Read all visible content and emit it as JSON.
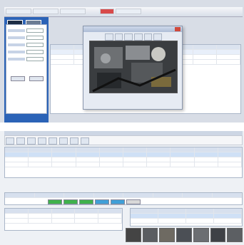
{
  "top": {
    "tabs": [
      "",
      "",
      "",
      "",
      "",
      "",
      "",
      ""
    ],
    "active_tab_index": 4,
    "left_table_headers": [
      "",
      "",
      "",
      "",
      ""
    ],
    "right_table_headers": [
      "",
      "",
      "",
      "",
      "",
      "",
      "",
      ""
    ],
    "dialog": {
      "title": "",
      "toolbar_icons": [
        "back-icon",
        "forward-icon",
        "print-icon",
        "zoom-in-icon",
        "zoom-out-icon",
        "rotate-icon"
      ]
    }
  },
  "bottom": {
    "toolbar_icons": [
      "new-icon",
      "open-icon",
      "save-icon",
      "print-icon",
      "search-icon",
      "delete-icon",
      "refresh-icon",
      "help-icon"
    ],
    "status_chips": [
      {
        "color": "#3fb24c"
      },
      {
        "color": "#3fb24c"
      },
      {
        "color": "#3fb24c"
      },
      {
        "color": "#3fa0d8"
      },
      {
        "color": "#3fa0d8"
      },
      {
        "color": "#d8d8d8"
      }
    ],
    "thumb_count": 7
  },
  "colors": {
    "accent_blue": "#2b63b7",
    "tab_active_red": "#d84a4a",
    "grid_border": "#aab6c8"
  }
}
